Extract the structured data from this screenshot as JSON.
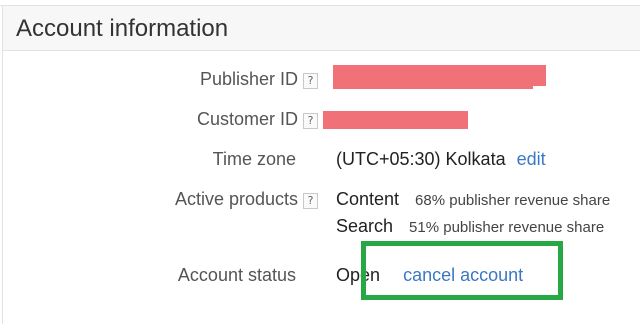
{
  "header": {
    "title": "Account information"
  },
  "fields": {
    "publisher_id": {
      "label": "Publisher ID",
      "help": "?"
    },
    "customer_id": {
      "label": "Customer ID",
      "help": "?"
    },
    "time_zone": {
      "label": "Time zone",
      "value": "(UTC+05:30) Kolkata",
      "edit_label": "edit"
    },
    "active_products": {
      "label": "Active products",
      "help": "?",
      "items": [
        {
          "name": "Content",
          "share": "68% publisher revenue share"
        },
        {
          "name": "Search",
          "share": "51% publisher revenue share"
        }
      ]
    },
    "account_status": {
      "label": "Account status",
      "value": "Open",
      "cancel_label": "cancel account"
    }
  },
  "colors": {
    "link": "#3a78c4",
    "redaction": "#f07178",
    "highlight": "#27a844"
  }
}
